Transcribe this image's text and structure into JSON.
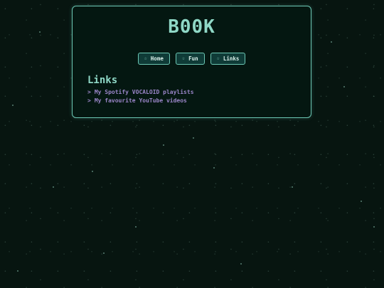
{
  "site": {
    "title": "B00K"
  },
  "nav": {
    "items": [
      {
        "label": "Home",
        "icon": "star-icon",
        "glyph": "☆"
      },
      {
        "label": "Fun",
        "icon": "star-icon",
        "glyph": "☆"
      },
      {
        "label": "Links",
        "icon": "star-icon",
        "glyph": "☆"
      }
    ]
  },
  "section": {
    "title": "Links",
    "marker": ">",
    "links": [
      {
        "label": "My Spotify VOCALOID playlists"
      },
      {
        "label": "My favourite YouTube videos"
      }
    ]
  },
  "colors": {
    "background": "#071510",
    "panel_border": "#6cc7b4",
    "heading": "#8fd8c6",
    "link": "#9b86c9"
  }
}
